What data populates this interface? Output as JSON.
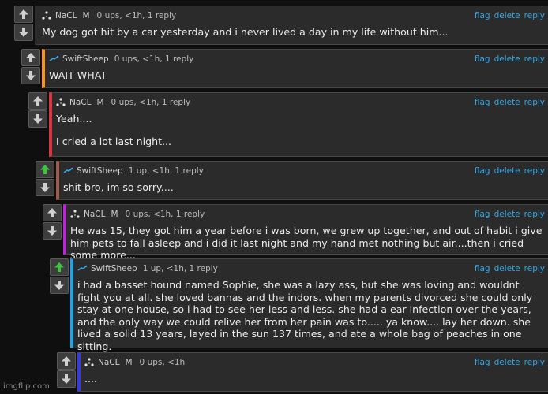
{
  "comments": [
    {
      "user": "NaCL",
      "badge": "M",
      "meta": "0 ups, <1h, 1 reply",
      "text": [
        "My dog got hit by a car yesterday and i never lived a day in my life without him..."
      ],
      "color": "#2b2b2b",
      "upvoted": false,
      "avatar": "dots-avatar-icon"
    },
    {
      "user": "SwiftSheep",
      "badge": "",
      "meta": "0 ups, <1h, 1 reply",
      "text": [
        "WAIT WHAT"
      ],
      "color": "#f7931e",
      "upvoted": false,
      "avatar": "sheep-avatar-icon"
    },
    {
      "user": "NaCL",
      "badge": "M",
      "meta": "0 ups, <1h, 1 reply",
      "text": [
        "Yeah....",
        "",
        "I cried a lot last night..."
      ],
      "color": "#d9363e",
      "upvoted": false,
      "avatar": "dots-avatar-icon"
    },
    {
      "user": "SwiftSheep",
      "badge": "",
      "meta": "1 up, <1h, 1 reply",
      "text": [
        "shit bro, im so sorry...."
      ],
      "color": "#9b5a4a",
      "upvoted": true,
      "avatar": "sheep-avatar-icon"
    },
    {
      "user": "NaCL",
      "badge": "M",
      "meta": "0 ups, <1h, 1 reply",
      "text": [
        "He was 15, they got him a year before i was born, we grew up together, and out of habit i give him pets to fall asleep and i did it last night and my hand met nothing but air....then i cried some more..."
      ],
      "color": "#b62bd1",
      "upvoted": false,
      "avatar": "dots-avatar-icon"
    },
    {
      "user": "SwiftSheep",
      "badge": "",
      "meta": "1 up, <1h, 1 reply",
      "text": [
        "i had a basset hound named Sophie, she was a lazy ass, but she was loving and wouldnt fight you at all. she loved bannas and the indors. when my parents divorced she could only stay at one house, so i had to see her less and less. she had a ear infection over the years, and the only way we could relive her from her pain was to..... ya know.... lay her down. she lived a solid 13 years, layed in the sun 137 times, and ate a whole bag of peaches in one sitting."
      ],
      "color": "#1ca6e8",
      "upvoted": true,
      "avatar": "sheep-avatar-icon"
    },
    {
      "user": "NaCL",
      "badge": "M",
      "meta": "0 ups, <1h",
      "text": [
        "...."
      ],
      "color": "#3a3ad4",
      "upvoted": false,
      "avatar": "dots-avatar-icon"
    }
  ],
  "actions": [
    "flag",
    "delete",
    "reply"
  ],
  "watermark": "imgflip.com"
}
